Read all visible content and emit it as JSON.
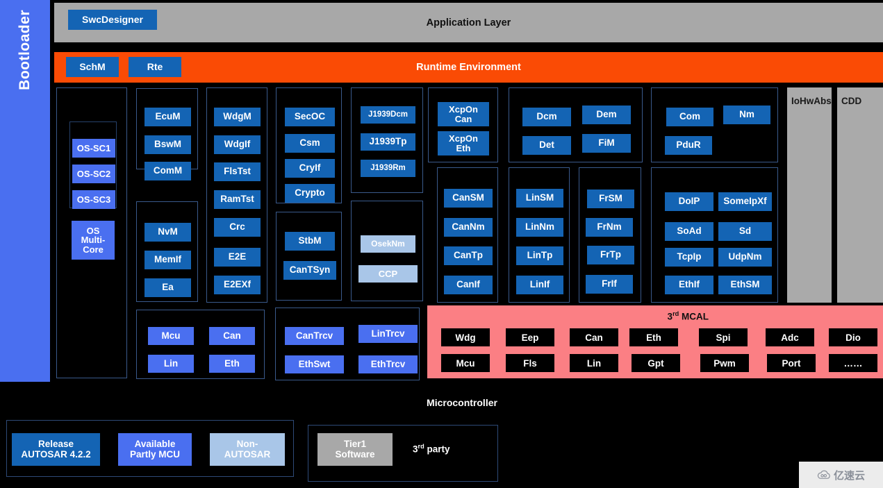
{
  "bootloader": {
    "label": "Bootloader",
    "color": "#4a6ff0"
  },
  "app_layer": {
    "title": "Application Layer",
    "color": "#a8a8a8",
    "chip": "SwcDesigner"
  },
  "rte": {
    "title": "Runtime Environment",
    "color": "#fa4b05",
    "chips": [
      "SchM",
      "Rte"
    ]
  },
  "os_column": {
    "sc_boxes": [
      "OS-SC1",
      "OS-SC2",
      "OS-SC3"
    ],
    "multicore": "OS\nMulti-\nCore",
    "multicore_lines": [
      "OS",
      "Multi-",
      "Core"
    ]
  },
  "groups": {
    "ecu_mode": [
      "EcuM",
      "BswM",
      "ComM"
    ],
    "memory": [
      "NvM",
      "MemIf",
      "Ea"
    ],
    "watchdog": [
      "WdgM",
      "WdgIf",
      "FlsTst",
      "RamTst",
      "Crc",
      "E2E",
      "E2EXf"
    ],
    "crypto": [
      "SecOC",
      "Csm",
      "CryIf",
      "Crypto"
    ],
    "time_sync": [
      "StbM",
      "CanTSyn"
    ],
    "j1939": [
      "J1939Dcm",
      "J1939Tp",
      "J1939Rm"
    ],
    "non_autosar_nm": [
      "OsekNm",
      "CCP"
    ],
    "xcp": [
      "XcpOn\nCan",
      "XcpOn\nEth"
    ],
    "xcp_lines": [
      [
        "XcpOn",
        "Can"
      ],
      [
        "XcpOn",
        "Eth"
      ]
    ],
    "diagnostics": [
      "Dcm",
      "Dem",
      "Det",
      "FiM"
    ],
    "com_pdur": [
      "Com",
      "Nm",
      "PduR"
    ],
    "can_stack": [
      "CanSM",
      "CanNm",
      "CanTp",
      "CanIf"
    ],
    "lin_stack": [
      "LinSM",
      "LinNm",
      "LinTp",
      "LinIf"
    ],
    "fr_stack": [
      "FrSM",
      "FrNm",
      "FrTp",
      "FrIf"
    ],
    "eth_stack": [
      "DoIP",
      "SomeIpXf",
      "SoAd",
      "Sd",
      "TcpIp",
      "UdpNm",
      "EthIf",
      "EthSM"
    ],
    "mcu_drivers": [
      "Mcu",
      "Can",
      "Lin",
      "Eth"
    ],
    "transceivers": [
      "CanTrcv",
      "LinTrcv",
      "EthSwt",
      "EthTrcv"
    ]
  },
  "gray_columns": [
    {
      "label": "IoHwAbs"
    },
    {
      "label": "CDD"
    }
  ],
  "mcal": {
    "title_prefix": "3",
    "title_sup": "rd",
    "title_suffix": " MCAL",
    "color": "#fb7f84",
    "row1": [
      "Wdg",
      "Eep",
      "Can",
      "Eth",
      "Spi",
      "Adc",
      "Dio"
    ],
    "row2": [
      "Mcu",
      "Fls",
      "Lin",
      "Gpt",
      "Pwm",
      "Port",
      "……"
    ]
  },
  "microcontroller_label": "Microcontroller",
  "legend": {
    "release": {
      "line1": "Release",
      "line2": "AUTOSAR 4.2.2",
      "color": "#1464b4"
    },
    "available": {
      "line1": "Available",
      "line2": "Partly MCU",
      "color": "#4a6ff0"
    },
    "nonautosar": {
      "line1": "Non-",
      "line2": "AUTOSAR",
      "color": "#a9c6e8"
    },
    "tier1": {
      "line1": "Tier1",
      "line2": "Software",
      "color": "#a8a8a8"
    },
    "thirdparty": {
      "prefix": "3",
      "sup": "rd",
      "suffix": " party"
    }
  },
  "watermark": {
    "text": "亿速云"
  }
}
